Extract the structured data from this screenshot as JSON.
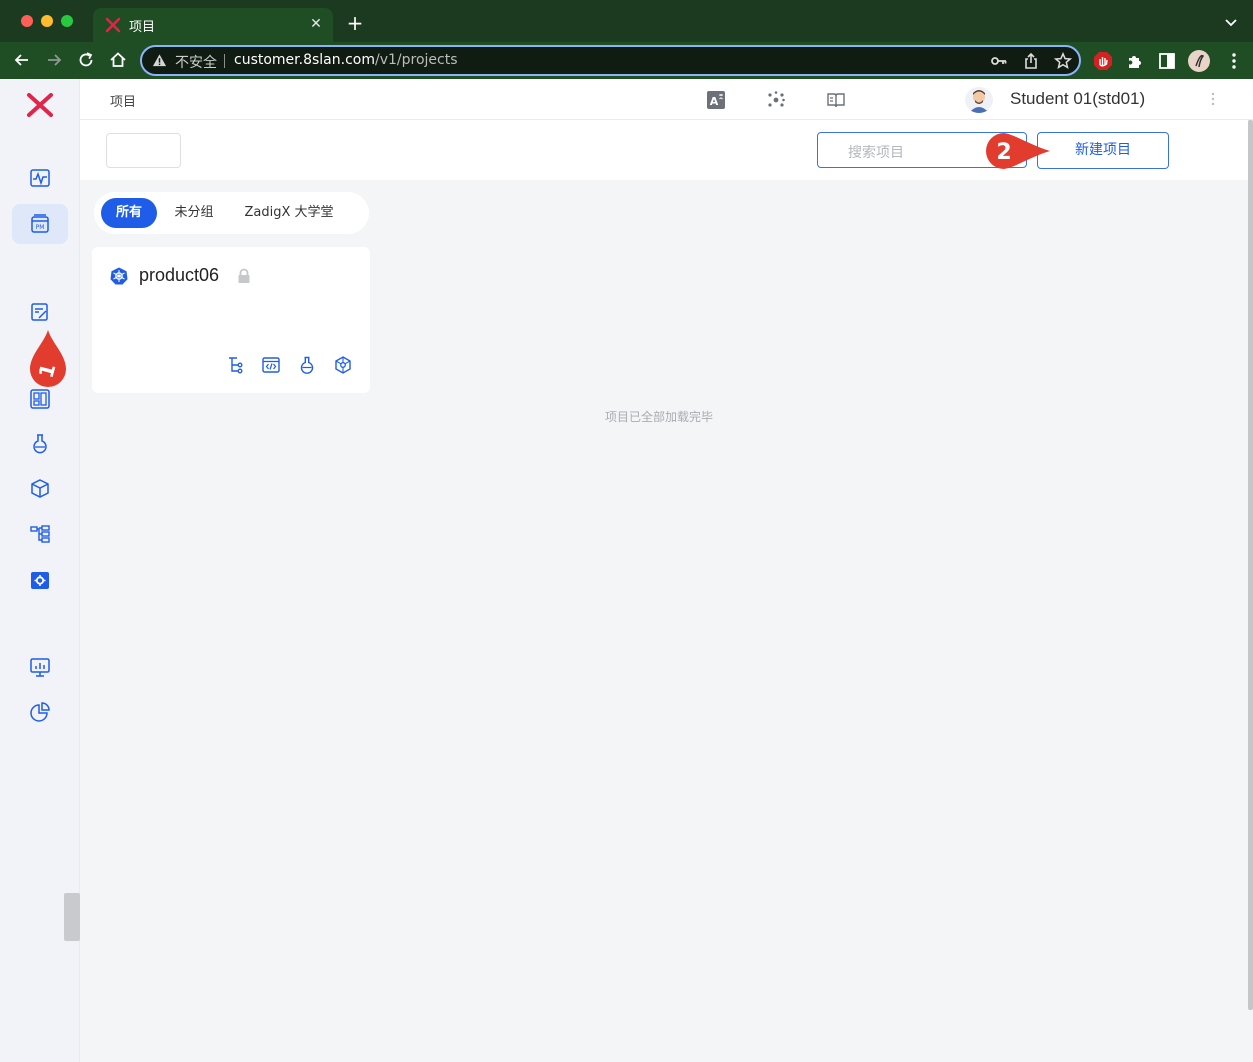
{
  "browser": {
    "tab_title": "项目",
    "new_tab_symbol": "+",
    "close_symbol": "✕",
    "insecure_label": "不安全",
    "url_host": "customer.8slan.com",
    "url_path": "/v1/projects"
  },
  "app": {
    "breadcrumb": "项目",
    "user_name": "Student 01(std01)",
    "search_placeholder": "搜索项目",
    "new_project_label": "新建项目",
    "filters": [
      "所有",
      "未分组",
      "ZadigX 大学堂"
    ],
    "active_filter": "所有",
    "projects": [
      {
        "name": "product06"
      }
    ],
    "loaded_message": "项目已全部加载完毕"
  },
  "annotations": {
    "marker_1": "1",
    "marker_2": "2"
  },
  "colors": {
    "accent": "#1f5de8",
    "brand": "#e0244a",
    "marker": "#e23c2e"
  },
  "icons": {
    "sidebar": [
      "monitor-wave-icon",
      "project-pm-icon",
      "doc-edit-icon",
      "dashboard-icon",
      "test-flask-icon",
      "artifact-cube-icon",
      "workflow-tree-icon",
      "settings-icon",
      "insight-screen-icon",
      "pie-chart-icon"
    ],
    "card_actions": [
      "workflow-icon",
      "service-code-icon",
      "test-icon",
      "environment-icon"
    ]
  }
}
